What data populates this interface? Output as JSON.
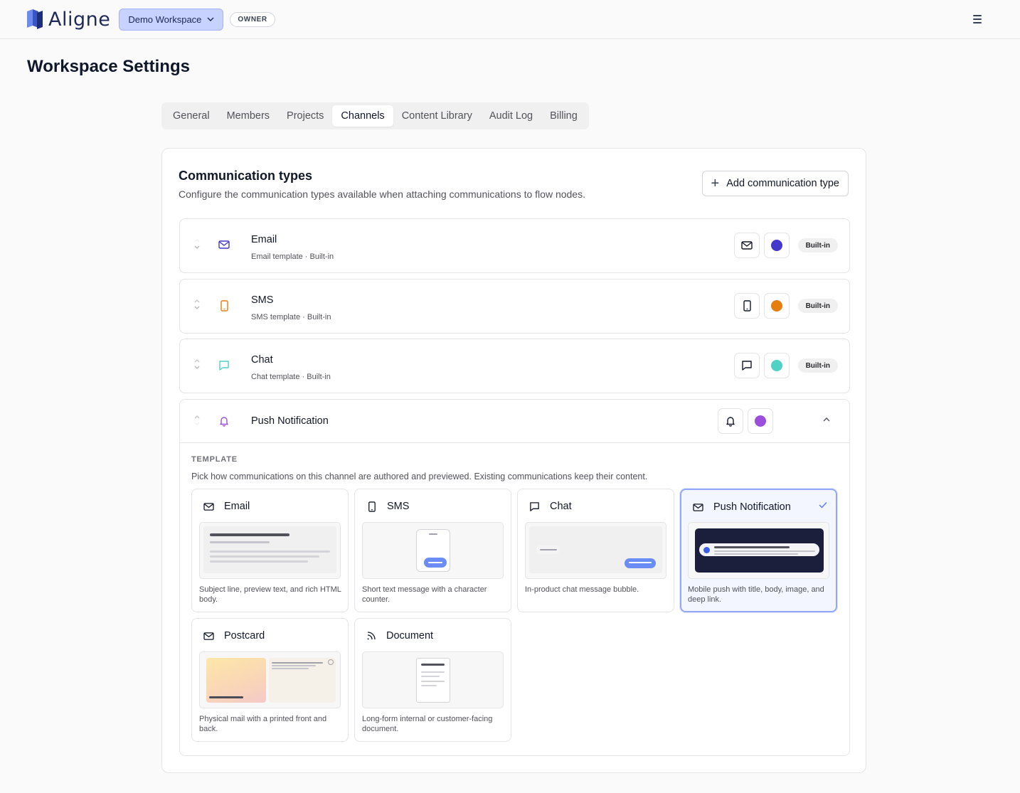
{
  "app": {
    "brand": "Aligne",
    "workspace_label": "Demo Workspace",
    "role_badge": "OWNER"
  },
  "page": {
    "title": "Workspace Settings"
  },
  "tabs": [
    {
      "label": "General",
      "active": false
    },
    {
      "label": "Members",
      "active": false
    },
    {
      "label": "Projects",
      "active": false
    },
    {
      "label": "Channels",
      "active": true
    },
    {
      "label": "Content Library",
      "active": false
    },
    {
      "label": "Audit Log",
      "active": false
    },
    {
      "label": "Billing",
      "active": false
    }
  ],
  "section": {
    "title": "Communication types",
    "subtitle": "Configure the communication types available when attaching communications to flow nodes.",
    "add_button": "Add communication type"
  },
  "channels": [
    {
      "name": "Email",
      "meta": "Email template · Built-in",
      "icon": "mail-icon",
      "color": "#4338ca",
      "badge": "Built-in"
    },
    {
      "name": "SMS",
      "meta": "SMS template · Built-in",
      "icon": "phone-icon",
      "color": "#e67e0f",
      "badge": "Built-in"
    },
    {
      "name": "Chat",
      "meta": "Chat template · Built-in",
      "icon": "chat-icon",
      "color": "#4fd1c5",
      "badge": "Built-in"
    }
  ],
  "expanded_channel": {
    "name": "Push Notification",
    "icon": "bell-icon",
    "color": "#9b4fdc",
    "template_label": "TEMPLATE",
    "template_hint": "Pick how communications on this channel are authored and previewed. Existing communications keep their content.",
    "templates": [
      {
        "name": "Email",
        "desc": "Subject line, preview text, and rich HTML body.",
        "selected": false
      },
      {
        "name": "SMS",
        "desc": "Short text message with a character counter.",
        "selected": false
      },
      {
        "name": "Chat",
        "desc": "In-product chat message bubble.",
        "selected": false
      },
      {
        "name": "Push Notification",
        "desc": "Mobile push with title, body, image, and deep link.",
        "selected": true
      },
      {
        "name": "Postcard",
        "desc": "Physical mail with a printed front and back.",
        "selected": false
      },
      {
        "name": "Document",
        "desc": "Long-form internal or customer-facing document.",
        "selected": false
      }
    ]
  }
}
